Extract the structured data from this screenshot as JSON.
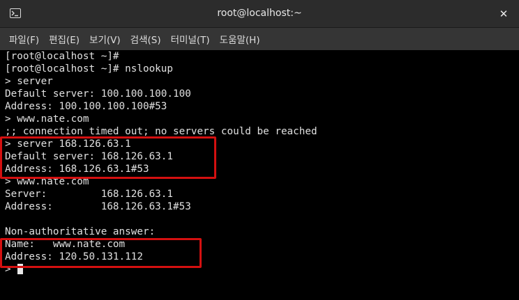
{
  "window": {
    "title": "root@localhost:~",
    "close_label": "✕"
  },
  "menu": [
    "파일(F)",
    "편집(E)",
    "보기(V)",
    "검색(S)",
    "터미널(T)",
    "도움말(H)"
  ],
  "terminal": {
    "lines": [
      "[root@localhost ~]#",
      "[root@localhost ~]# nslookup",
      "> server",
      "Default server: 100.100.100.100",
      "Address: 100.100.100.100#53",
      "> www.nate.com",
      ";; connection timed out; no servers could be reached",
      "> server 168.126.63.1",
      "Default server: 168.126.63.1",
      "Address: 168.126.63.1#53",
      "> www.nate.com",
      "Server:         168.126.63.1",
      "Address:        168.126.63.1#53",
      "",
      "Non-authoritative answer:",
      "Name:   www.nate.com",
      "Address: 120.50.131.112"
    ],
    "prompt": ">"
  },
  "colors": {
    "terminal_bg": "#000000",
    "terminal_fg": "#e0e0e0",
    "titlebar_bg": "#2c2c2c",
    "menubar_bg": "#353535",
    "highlight": "#d41010"
  }
}
